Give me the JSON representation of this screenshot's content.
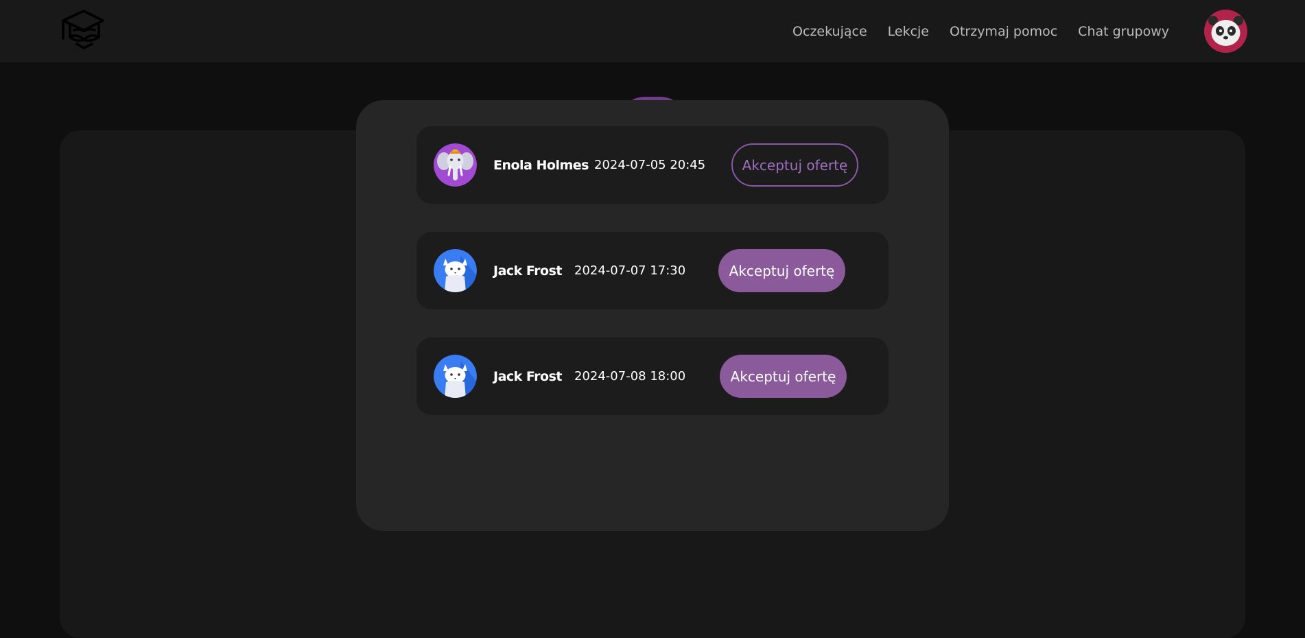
{
  "nav": {
    "logo_icon": "graduation-cap-book-icon",
    "links": [
      "Oczekujące",
      "Lekcje",
      "Otrzymaj pomoc",
      "Chat grupowy"
    ],
    "avatar_icon": "panda-avatar-icon"
  },
  "offers": [
    {
      "name": "Enola Holmes",
      "date": "2024-07-05 20:45",
      "button_label": "Akceptuj ofertę",
      "avatar_icon": "elephant-avatar-icon"
    },
    {
      "name": "Jack Frost",
      "date": "2024-07-07 17:30",
      "button_label": "Akceptuj ofertę",
      "avatar_icon": "cat-avatar-icon"
    },
    {
      "name": "Jack Frost",
      "date": "2024-07-08 18:00",
      "button_label": "Akceptuj ofertę",
      "avatar_icon": "cat-avatar-icon"
    }
  ],
  "colors": {
    "accent": "#8a5a9b",
    "background": "#0f0f0f",
    "navbar": "#191919",
    "modal": "#262626",
    "card": "#1c1c1c"
  }
}
